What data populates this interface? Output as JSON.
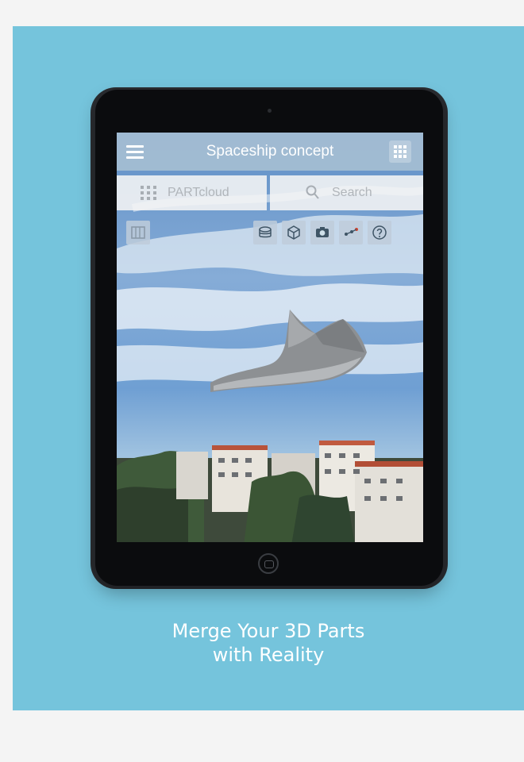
{
  "app": {
    "title": "Spaceship concept",
    "partcloud_label": "PARTcloud",
    "search_placeholder": "Search"
  },
  "toolbar": {
    "left_icon": "library-icon",
    "right_icons": [
      "layers-icon",
      "cube-icon",
      "camera-icon",
      "share-icon",
      "help-icon"
    ]
  },
  "tagline": {
    "line1": "Merge Your 3D Parts",
    "line2": "with Reality"
  },
  "colors": {
    "panel": "#75c4dc",
    "background": "#f4f4f4",
    "device": "#0b0c0e"
  }
}
